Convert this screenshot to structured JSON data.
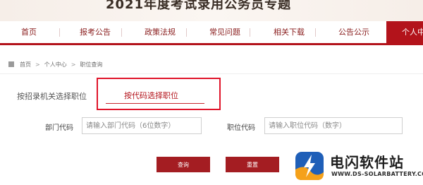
{
  "banner": {
    "title": "2021年度考试录用公务员专题"
  },
  "nav": {
    "items": [
      {
        "label": "首页"
      },
      {
        "label": "报考公告"
      },
      {
        "label": "政策法规"
      },
      {
        "label": "常见问题"
      },
      {
        "label": "相关下载"
      },
      {
        "label": "公告公示"
      },
      {
        "label": "个人中"
      }
    ],
    "active_index": 6,
    "accent_color": "#b3131b"
  },
  "breadcrumb": {
    "items": [
      "首页",
      "个人中心",
      "职位查询"
    ],
    "separator": ">"
  },
  "tabs": {
    "items": [
      {
        "label": "按招录机关选择职位"
      },
      {
        "label": "按代码选择职位"
      }
    ],
    "selected_index": 1
  },
  "form": {
    "dept_label": "部门代码",
    "dept_placeholder": "请输入部门代码（6位数字）",
    "pos_label": "职位代码",
    "pos_placeholder": "请输入职位代码（数字）"
  },
  "buttons": {
    "query": "查询",
    "reset": "重置"
  },
  "watermark": {
    "name": "电闪软件站",
    "url": "WWW.DS-SOLARBATTERY.COM"
  }
}
